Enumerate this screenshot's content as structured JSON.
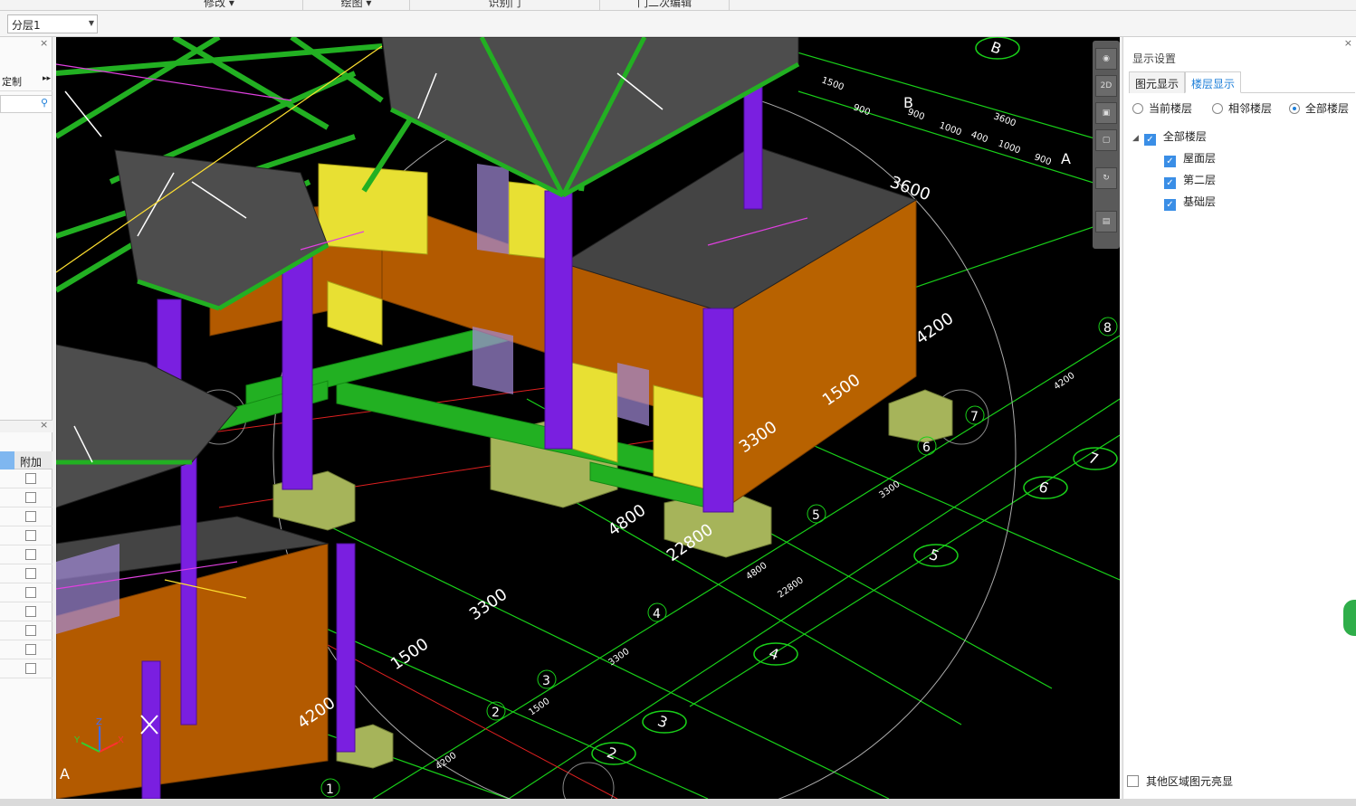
{
  "menu": {
    "tabs": [
      "修改",
      "绘图",
      "识别门",
      "门二次编辑"
    ]
  },
  "layer_select": {
    "value": "分层1"
  },
  "left_panel": {
    "label_top": "定制",
    "column_header": "附加",
    "row_count": 11
  },
  "right_panel": {
    "title": "显示设置",
    "tabs": [
      {
        "label": "图元显示"
      },
      {
        "label": "楼层显示"
      }
    ],
    "radios": [
      {
        "label": "当前楼层"
      },
      {
        "label": "相邻楼层"
      },
      {
        "label": "全部楼层"
      }
    ],
    "tree": {
      "root": "全部楼层",
      "children": [
        "屋面层",
        "第二层",
        "基础层"
      ]
    },
    "bottom_check": "其他区域图元亮显"
  },
  "viewport": {
    "dimension_labels": [
      "3600",
      "4200",
      "1500",
      "3300",
      "4800",
      "22800",
      "3300",
      "1500",
      "4200"
    ],
    "axis_labels": [
      "B",
      "A",
      "8",
      "7",
      "6",
      "5",
      "4",
      "3",
      "2",
      "1",
      "A"
    ],
    "circled_axes": [
      "B",
      "7",
      "6",
      "5",
      "4",
      "3",
      "2"
    ],
    "small_dims": [
      "1500",
      "900",
      "900",
      "1000",
      "400",
      "1000",
      "900",
      "3600",
      "3300",
      "3300",
      "4800",
      "22800",
      "3300",
      "1500",
      "4200",
      "4200"
    ],
    "toolbar_label": "2D"
  },
  "colors": {
    "wall": "#b35a00",
    "column": "#7a1fe0",
    "beam": "#22b022",
    "slab": "#555555",
    "yellow": "#e8e033",
    "footing": "#a6b45a",
    "accent": "#1e7fd9"
  }
}
